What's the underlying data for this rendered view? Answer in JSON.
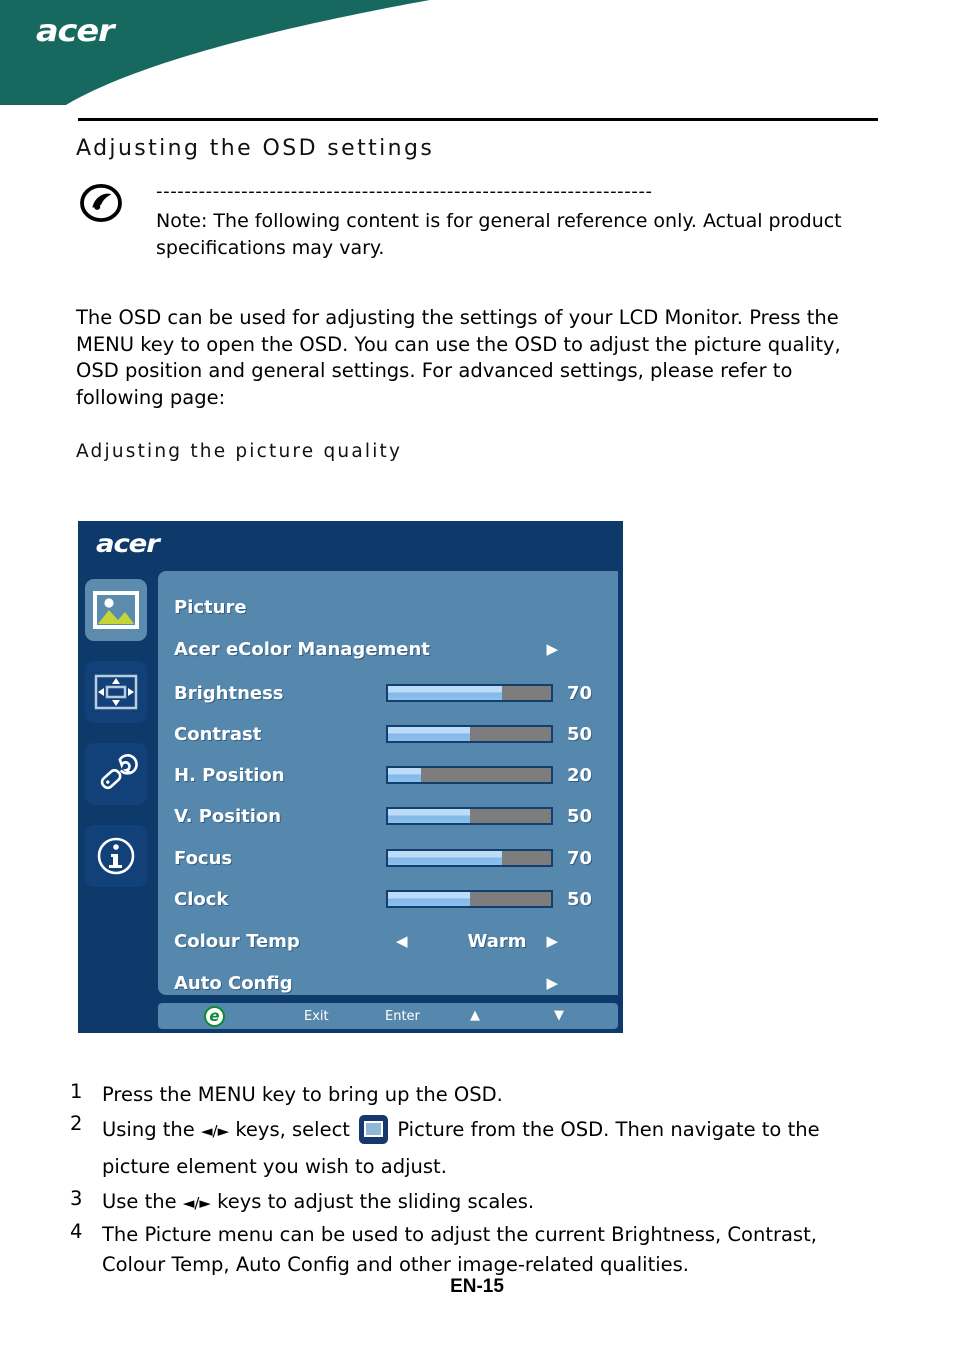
{
  "header": {
    "logo_text": "acer",
    "banner_color": "#176960"
  },
  "page_title": "Adjusting  the  OSD  settings",
  "sub_title": "Adjusting  the  picture  quality",
  "note": {
    "icon": "note-circle-icon",
    "dashes": "----------------------------------------------------------------------",
    "text": "Note: The following content is for general reference only. Actual product specifications may vary."
  },
  "body_paragraph": "The OSD can be used for adjusting the settings of your LCD Monitor. Press the MENU key to open the OSD. You can use the OSD to adjust the picture quality, OSD position and general settings. For advanced settings, please refer to following page:",
  "osd": {
    "logo_text": "acer",
    "colors": {
      "navy": "#0d3a6b",
      "panel": "#5588ac",
      "slider_track": "#7d7d7d",
      "slider_fill": "#a9d2f2",
      "e_green": "#0c8a2e"
    },
    "sidebar_icons": [
      {
        "name": "picture-icon",
        "selected": true
      },
      {
        "name": "osd-position-icon",
        "selected": false
      },
      {
        "name": "setting-wrench-icon",
        "selected": false
      },
      {
        "name": "information-icon",
        "selected": false
      }
    ],
    "menu_heading": "Picture",
    "rows": [
      {
        "label": "Acer eColor Management",
        "type": "submenu"
      },
      {
        "label": "Brightness",
        "type": "slider",
        "value": 70
      },
      {
        "label": "Contrast",
        "type": "slider",
        "value": 50
      },
      {
        "label": "H. Position",
        "type": "slider",
        "value": 20
      },
      {
        "label": "V. Position",
        "type": "slider",
        "value": 50
      },
      {
        "label": "Focus",
        "type": "slider",
        "value": 70
      },
      {
        "label": "Clock",
        "type": "slider",
        "value": 50
      },
      {
        "label": "Colour Temp",
        "type": "option",
        "value": "Warm"
      },
      {
        "label": "Auto Config",
        "type": "submenu"
      }
    ],
    "footer": {
      "e_logo": "e",
      "exit_label": "Exit",
      "enter_label": "Enter",
      "up_glyph": "▲",
      "down_glyph": "▼"
    }
  },
  "steps": [
    {
      "num": "1",
      "text": "Press the MENU key to bring up the OSD."
    },
    {
      "num": "2",
      "text_before": "Using the ",
      "keys": "◄/►",
      "text_mid": " keys, select ",
      "icon": "picture-icon",
      "text_after": " Picture from the OSD. Then navigate to the picture element you wish to adjust."
    },
    {
      "num": "3",
      "text_before": "Use the ",
      "keys": "◄/►",
      "text_mid": " keys to adjust the sliding scales.",
      "text_after": ""
    },
    {
      "num": "4",
      "text": "The Picture menu can be used to adjust the current Brightness, Contrast, Colour Temp, Auto Config and other image-related qualities."
    }
  ],
  "page_footer": "EN-15"
}
